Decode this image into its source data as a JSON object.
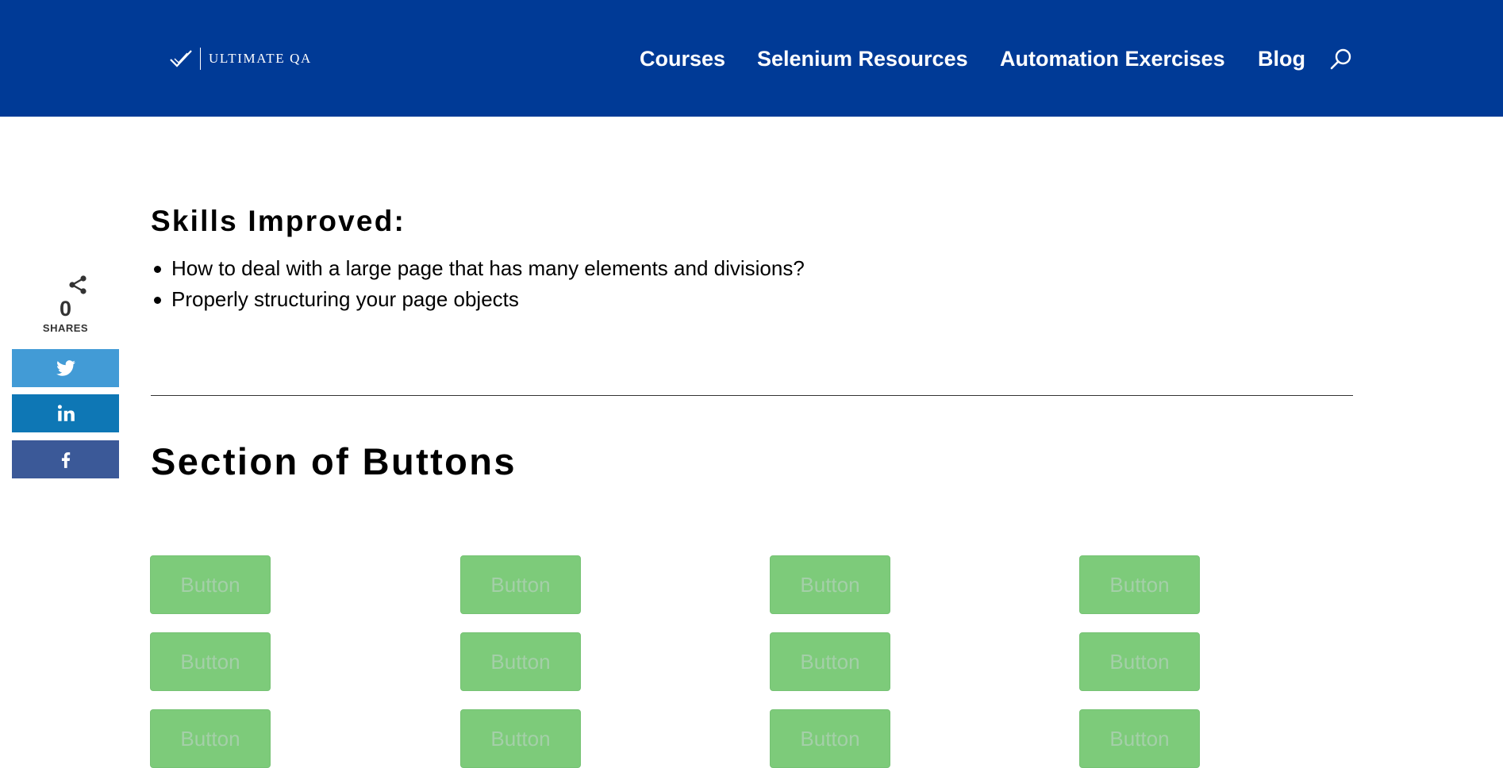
{
  "header": {
    "logo_text": "ULTIMATE QA",
    "nav": [
      "Courses",
      "Selenium Resources",
      "Automation Exercises",
      "Blog"
    ]
  },
  "share": {
    "count": "0",
    "label": "SHARES",
    "colors": {
      "twitter": "#429bd6",
      "linkedin": "#0e77b5",
      "facebook": "#3b5998"
    }
  },
  "skills": {
    "title": "Skills Improved:",
    "items": [
      "How to deal with a large page that has many elements and divisions?",
      "Properly structuring your page objects"
    ]
  },
  "section": {
    "title": "Section of Buttons"
  },
  "buttons": {
    "label": "Button"
  },
  "colors": {
    "header_bg": "#003a96",
    "button_bg": "#7dcb7a",
    "button_text": "#a4cfa8"
  }
}
